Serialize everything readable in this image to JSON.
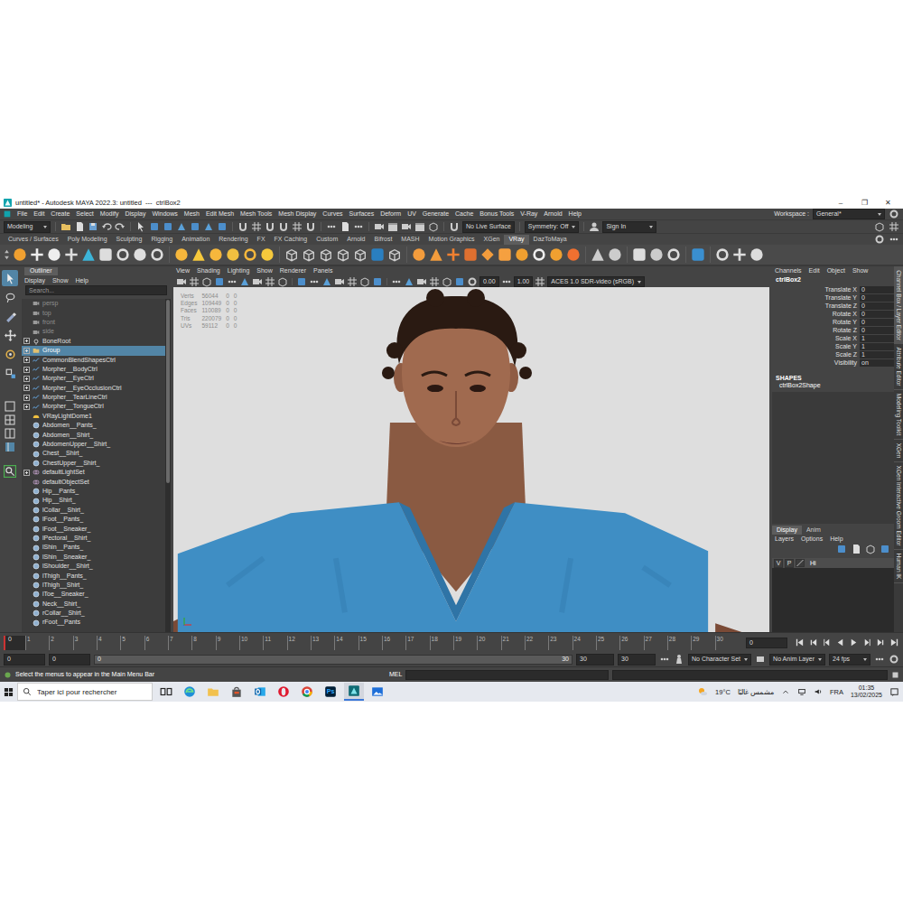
{
  "window": {
    "title": "untitled* - Autodesk MAYA 2022.3: untitled  ---  ctrlBox2",
    "controls": [
      "–",
      "❐",
      "✕"
    ]
  },
  "menu_bar": {
    "items": [
      "File",
      "Edit",
      "Create",
      "Select",
      "Modify",
      "Display",
      "Windows",
      "Mesh",
      "Edit Mesh",
      "Mesh Tools",
      "Mesh Display",
      "Curves",
      "Surfaces",
      "Deform",
      "UV",
      "Generate",
      "Cache",
      "Bonus Tools",
      "V-Ray",
      "Arnold",
      "Help"
    ],
    "workspace_label": "Workspace :",
    "workspace": "General*"
  },
  "status_line": {
    "mode": "Modeling",
    "live_surface": "No Live Surface",
    "symmetry": "Symmetry: Off",
    "sign_in": "Sign In"
  },
  "shelf": {
    "tabs": [
      {
        "label": "Curves / Surfaces",
        "selected": false
      },
      {
        "label": "Poly Modeling",
        "selected": false
      },
      {
        "label": "Sculpting",
        "selected": false
      },
      {
        "label": "Rigging",
        "selected": false
      },
      {
        "label": "Animation",
        "selected": false
      },
      {
        "label": "Rendering",
        "selected": false
      },
      {
        "label": "FX",
        "selected": false
      },
      {
        "label": "FX Caching",
        "selected": false
      },
      {
        "label": "Custom",
        "selected": false
      },
      {
        "label": "Arnold",
        "selected": false
      },
      {
        "label": "Bifrost",
        "selected": false
      },
      {
        "label": "MASH",
        "selected": false
      },
      {
        "label": "Motion Graphics",
        "selected": false
      },
      {
        "label": "XGen",
        "selected": false
      },
      {
        "label": "VRay",
        "selected": true
      },
      {
        "label": "DazToMaya",
        "selected": false
      }
    ]
  },
  "outliner": {
    "title": "Outliner",
    "menu": [
      "Display",
      "Show",
      "Help"
    ],
    "search": {
      "placeholder": "Search..."
    },
    "items": [
      {
        "label": "persp",
        "kind": "camera",
        "expandable": false,
        "selected": false,
        "hidden": true
      },
      {
        "label": "top",
        "kind": "camera",
        "expandable": false,
        "selected": false,
        "hidden": true
      },
      {
        "label": "front",
        "kind": "camera",
        "expandable": false,
        "selected": false,
        "hidden": true
      },
      {
        "label": "side",
        "kind": "camera",
        "expandable": false,
        "selected": false,
        "hidden": true
      },
      {
        "label": "BoneRoot",
        "kind": "joint",
        "expandable": true,
        "selected": false,
        "hidden": false
      },
      {
        "label": "Group",
        "kind": "group",
        "expandable": true,
        "selected": true,
        "hidden": false
      },
      {
        "label": "CommonBlendShapesCtrl",
        "kind": "ctrl",
        "expandable": true,
        "selected": false,
        "hidden": false
      },
      {
        "label": "Morpher__BodyCtrl",
        "kind": "ctrl",
        "expandable": true,
        "selected": false,
        "hidden": false
      },
      {
        "label": "Morpher__EyeCtrl",
        "kind": "ctrl",
        "expandable": true,
        "selected": false,
        "hidden": false
      },
      {
        "label": "Morpher__EyeOcclusionCtrl",
        "kind": "ctrl",
        "expandable": true,
        "selected": false,
        "hidden": false
      },
      {
        "label": "Morpher__TearLineCtrl",
        "kind": "ctrl",
        "expandable": true,
        "selected": false,
        "hidden": false
      },
      {
        "label": "Morpher__TongueCtrl",
        "kind": "ctrl",
        "expandable": true,
        "selected": false,
        "hidden": false
      },
      {
        "label": "VRayLightDome1",
        "kind": "light",
        "expandable": false,
        "selected": false,
        "hidden": false
      },
      {
        "label": "Abdomen__Pants_",
        "kind": "mesh",
        "expandable": false,
        "selected": false,
        "hidden": false
      },
      {
        "label": "Abdomen__Shirt_",
        "kind": "mesh",
        "expandable": false,
        "selected": false,
        "hidden": false
      },
      {
        "label": "AbdomenUpper__Shirt_",
        "kind": "mesh",
        "expandable": false,
        "selected": false,
        "hidden": false
      },
      {
        "label": "Chest__Shirt_",
        "kind": "mesh",
        "expandable": false,
        "selected": false,
        "hidden": false
      },
      {
        "label": "ChestUpper__Shirt_",
        "kind": "mesh",
        "expandable": false,
        "selected": false,
        "hidden": false
      },
      {
        "label": "defaultLightSet",
        "kind": "set",
        "expandable": true,
        "selected": false,
        "hidden": false
      },
      {
        "label": "defaultObjectSet",
        "kind": "set",
        "expandable": false,
        "selected": false,
        "hidden": false
      },
      {
        "label": "Hip__Pants_",
        "kind": "mesh",
        "expandable": false,
        "selected": false,
        "hidden": false
      },
      {
        "label": "Hip__Shirt_",
        "kind": "mesh",
        "expandable": false,
        "selected": false,
        "hidden": false
      },
      {
        "label": "lCollar__Shirt_",
        "kind": "mesh",
        "expandable": false,
        "selected": false,
        "hidden": false
      },
      {
        "label": "lFoot__Pants_",
        "kind": "mesh",
        "expandable": false,
        "selected": false,
        "hidden": false
      },
      {
        "label": "lFoot__Sneaker_",
        "kind": "mesh",
        "expandable": false,
        "selected": false,
        "hidden": false
      },
      {
        "label": "lPectoral__Shirt_",
        "kind": "mesh",
        "expandable": false,
        "selected": false,
        "hidden": false
      },
      {
        "label": "lShin__Pants_",
        "kind": "mesh",
        "expandable": false,
        "selected": false,
        "hidden": false
      },
      {
        "label": "lShin__Sneaker_",
        "kind": "mesh",
        "expandable": false,
        "selected": false,
        "hidden": false
      },
      {
        "label": "lShoulder__Shirt_",
        "kind": "mesh",
        "expandable": false,
        "selected": false,
        "hidden": false
      },
      {
        "label": "lThigh__Pants_",
        "kind": "mesh",
        "expandable": false,
        "selected": false,
        "hidden": false
      },
      {
        "label": "lThigh__Shirt_",
        "kind": "mesh",
        "expandable": false,
        "selected": false,
        "hidden": false
      },
      {
        "label": "lToe__Sneaker_",
        "kind": "mesh",
        "expandable": false,
        "selected": false,
        "hidden": false
      },
      {
        "label": "Neck__Shirt_",
        "kind": "mesh",
        "expandable": false,
        "selected": false,
        "hidden": false
      },
      {
        "label": "rCollar__Shirt_",
        "kind": "mesh",
        "expandable": false,
        "selected": false,
        "hidden": false
      },
      {
        "label": "rFoot__Pants",
        "kind": "mesh",
        "expandable": false,
        "selected": false,
        "hidden": false
      }
    ]
  },
  "viewport": {
    "menu": [
      "View",
      "Shading",
      "Lighting",
      "Show",
      "Renderer",
      "Panels"
    ],
    "exposure": "0.00",
    "gamma": "1.00",
    "color_space": "ACES 1.0 SDR-video (sRGB)",
    "hud": [
      {
        "label": "Verts",
        "value": "56044",
        "selected": "0",
        "components": "0"
      },
      {
        "label": "Edges",
        "value": "109449",
        "selected": "0",
        "components": "0"
      },
      {
        "label": "Faces",
        "value": "110089",
        "selected": "0",
        "components": "0"
      },
      {
        "label": "Tris",
        "value": "220079",
        "selected": "0",
        "components": "0"
      },
      {
        "label": "UVs",
        "value": "59112",
        "selected": "0",
        "components": "0"
      }
    ]
  },
  "channel_box": {
    "tabs": [
      "Channels",
      "Edit",
      "Object",
      "Show"
    ],
    "object": "ctrlBox2",
    "attributes": [
      {
        "name": "Translate X",
        "value": "0"
      },
      {
        "name": "Translate Y",
        "value": "0"
      },
      {
        "name": "Translate Z",
        "value": "0"
      },
      {
        "name": "Rotate X",
        "value": "0"
      },
      {
        "name": "Rotate Y",
        "value": "0"
      },
      {
        "name": "Rotate Z",
        "value": "0"
      },
      {
        "name": "Scale X",
        "value": "1"
      },
      {
        "name": "Scale Y",
        "value": "1"
      },
      {
        "name": "Scale Z",
        "value": "1"
      },
      {
        "name": "Visibility",
        "value": "on"
      }
    ],
    "shapes_header": "SHAPES",
    "shape": "ctrlBox2Shape"
  },
  "layer_editor": {
    "tabs": [
      {
        "label": "Display",
        "selected": true
      },
      {
        "label": "Anim",
        "selected": false
      }
    ],
    "menu": [
      "Layers",
      "Options",
      "Help"
    ],
    "layers": [
      {
        "visible": "V",
        "playback": "P",
        "name": "Hi"
      }
    ]
  },
  "side_tabs": [
    {
      "label": "Channel Box / Layer Editor",
      "selected": true
    },
    {
      "label": "Attribute Editor",
      "selected": false
    },
    {
      "label": "Modeling Toolkit",
      "selected": false
    },
    {
      "label": "XGen",
      "selected": false
    },
    {
      "label": "XGen Interactive Groom Editor",
      "selected": false
    },
    {
      "label": "Human IK",
      "selected": false
    }
  ],
  "time_slider": {
    "current": "0",
    "ticks": [
      "1",
      "2",
      "3",
      "4",
      "5",
      "6",
      "7",
      "8",
      "9",
      "10",
      "11",
      "12",
      "13",
      "14",
      "15",
      "16",
      "17",
      "18",
      "19",
      "20",
      "21",
      "22",
      "23",
      "24",
      "25",
      "26",
      "27",
      "28",
      "29",
      "30"
    ],
    "current_field": "0"
  },
  "range_slider": {
    "start": "0",
    "min": "0",
    "handle_start": "0",
    "handle_end": "30",
    "end": "30",
    "max": "30",
    "character_set": "No Character Set",
    "anim_layer": "No Anim Layer",
    "fps": "24 fps"
  },
  "command_line": {
    "help": "Select the menus to appear in the Main Menu Bar",
    "language": "MEL"
  },
  "taskbar": {
    "search": {
      "placeholder": "Taper ici pour rechercher"
    },
    "apps": [
      {
        "kind": "taskview",
        "label": "",
        "active": false
      },
      {
        "kind": "edge",
        "label": "",
        "active": false
      },
      {
        "kind": "explorer",
        "label": "",
        "active": false
      },
      {
        "kind": "store",
        "label": "",
        "active": false
      },
      {
        "kind": "outlook",
        "label": "",
        "active": false
      },
      {
        "kind": "opera",
        "label": "",
        "active": false
      },
      {
        "kind": "chrome",
        "label": "",
        "active": false
      },
      {
        "kind": "photoshop",
        "label": "Ps",
        "active": false
      },
      {
        "kind": "maya",
        "label": "",
        "active": true
      },
      {
        "kind": "photos",
        "label": "",
        "active": false
      }
    ],
    "temperature": "19°C",
    "weather": "مشمس غالبًا",
    "language": "FRA",
    "time": "01:35",
    "date": "13/02/2025"
  }
}
